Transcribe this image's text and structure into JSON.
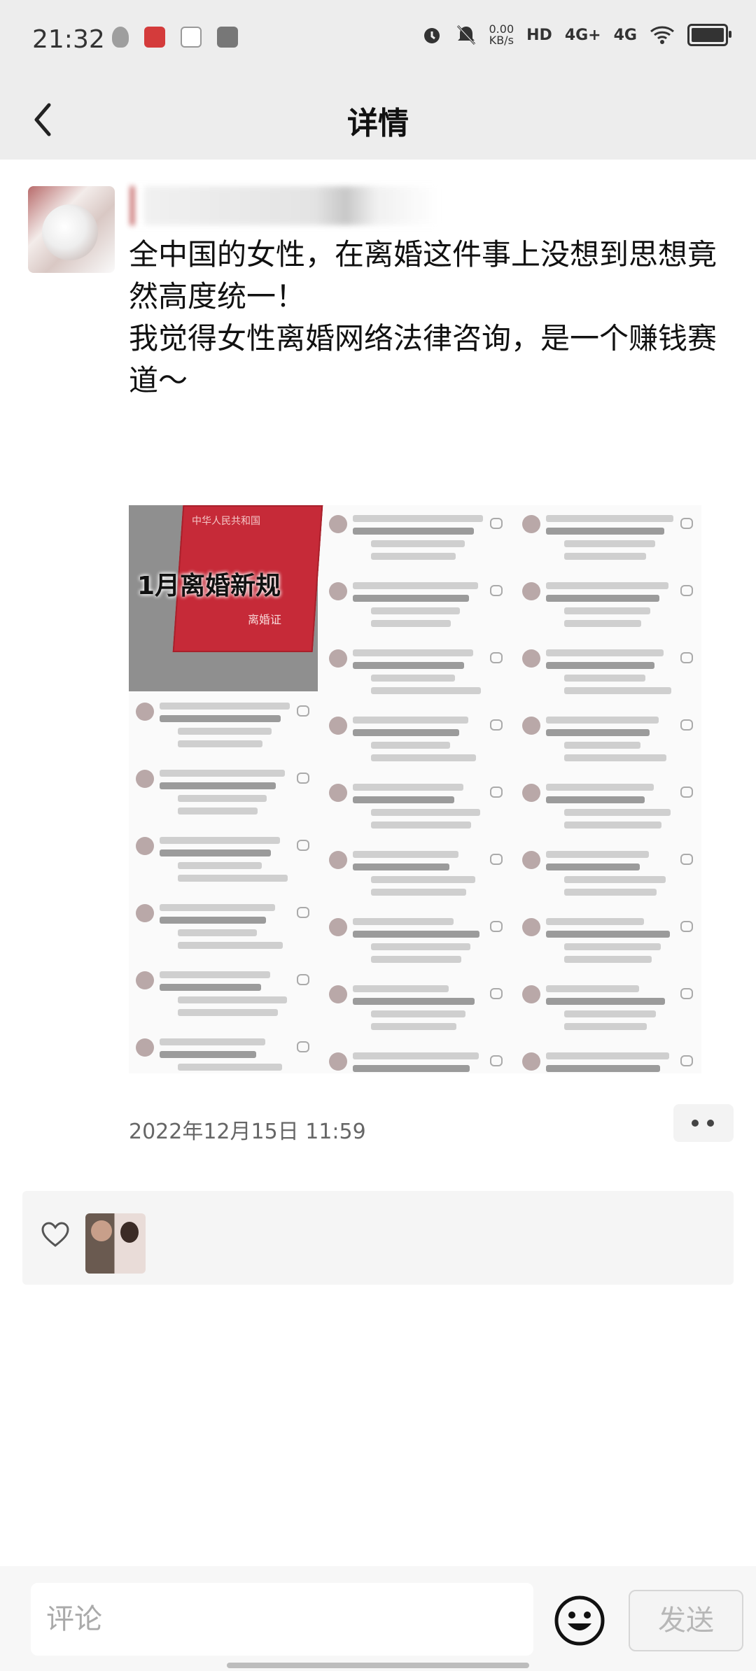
{
  "status_bar": {
    "time": "21:32",
    "net_speed": "0.00",
    "net_speed_unit": "KB/s",
    "hd_badge": "HD",
    "signal_1": "4G+",
    "signal_2": "4G"
  },
  "header": {
    "title": "详情",
    "back_icon": "chevron-left-icon"
  },
  "post": {
    "text": "全中国的女性，在离婚这件事上没想到思想竟然高度统一！\n我觉得女性离婚网络法律咨询，是一个赚钱赛道～",
    "image_title": "1月离婚新规",
    "image_top_label": "中华人民共和国",
    "image_sub_label": "离婚证",
    "timestamp": "2022年12月15日 11:59",
    "more_icon": "ellipsis-icon"
  },
  "likes": {
    "icon": "heart-outline-icon"
  },
  "bottom_bar": {
    "comment_placeholder": "评论",
    "emoji_icon": "smiley-icon",
    "send_label": "发送"
  }
}
